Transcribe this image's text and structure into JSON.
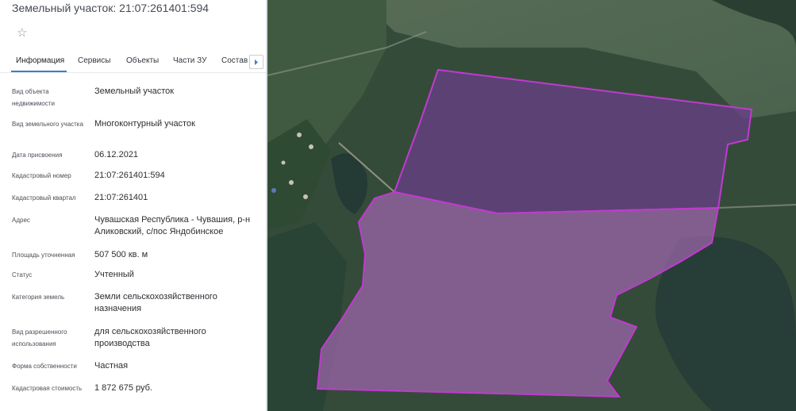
{
  "header": {
    "title": "Земельный участок: 21:07:261401:594",
    "favorite_icon": "star-outline-icon"
  },
  "tabs": [
    {
      "label": "Информация",
      "active": true
    },
    {
      "label": "Сервисы",
      "active": false
    },
    {
      "label": "Объекты",
      "active": false
    },
    {
      "label": "Части ЗУ",
      "active": false
    },
    {
      "label": "Состав",
      "active": false
    }
  ],
  "tab_scroll_icon": "chevron-right-icon",
  "info": [
    {
      "label": "Вид объекта недвижимости",
      "value": "Земельный участок"
    },
    {
      "label": "Вид земельного участка",
      "value": "Многоконтурный участок"
    },
    {
      "label": "Дата присвоения",
      "value": "06.12.2021"
    },
    {
      "label": "Кадастровый номер",
      "value": "21:07:261401:594"
    },
    {
      "label": "Кадастровый квартал",
      "value": "21:07:261401"
    },
    {
      "label": "Адрес",
      "value": "Чувашская Республика - Чувашия, р-н Аликовский, с/пос Яндобинское"
    },
    {
      "label": "Площадь уточненная",
      "value": "507 500 кв. м"
    },
    {
      "label": "Статус",
      "value": "Учтенный"
    },
    {
      "label": "Категория земель",
      "value": "Земли сельскохозяйственного назначения"
    },
    {
      "label": "Вид разрешенного использования",
      "value": "для сельскохозяйственного производства"
    },
    {
      "label": "Форма собственности",
      "value": "Частная"
    },
    {
      "label": "Кадастровая стоимость",
      "value": "1 872 675 руб."
    }
  ],
  "colors": {
    "accent": "#3b7bd4",
    "parcel_fill": "#9b4fa8",
    "parcel_stroke": "#c13ad0"
  }
}
